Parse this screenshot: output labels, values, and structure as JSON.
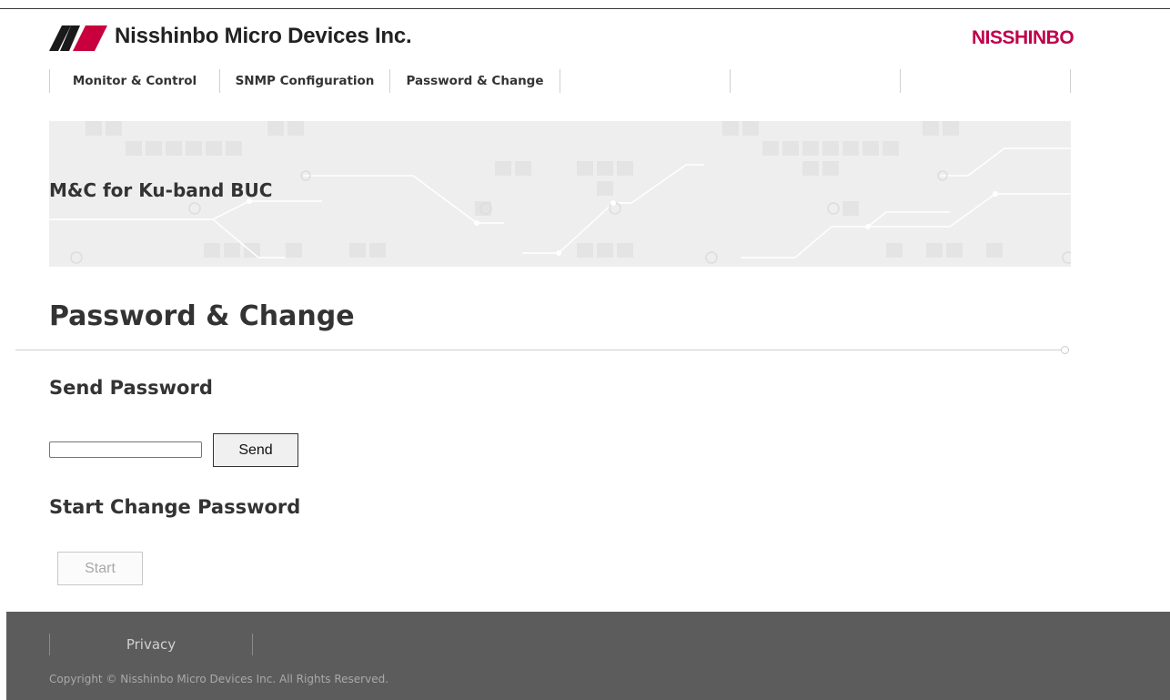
{
  "header": {
    "company_name": "Nisshinbo Micro Devices Inc.",
    "brand_wordmark": "NISSHINBO",
    "brand_color": "#c0004a",
    "logo_icon": "nisshinbo-n-logo-icon"
  },
  "nav": {
    "items": [
      {
        "label": "Monitor & Control"
      },
      {
        "label": "SNMP Configuration"
      },
      {
        "label": "Password & Change"
      },
      {
        "label": ""
      },
      {
        "label": ""
      },
      {
        "label": ""
      }
    ]
  },
  "banner": {
    "title": "M&C for Ku-band BUC"
  },
  "main": {
    "page_title": "Password & Change",
    "send_section": {
      "heading": "Send Password",
      "input_value": "",
      "button_label": "Send"
    },
    "start_section": {
      "heading": "Start Change Password",
      "button_label": "Start",
      "button_disabled": true
    }
  },
  "footer": {
    "privacy_link": "Privacy",
    "copyright": "Copyright © Nisshinbo Micro Devices Inc. All Rights Reserved."
  }
}
